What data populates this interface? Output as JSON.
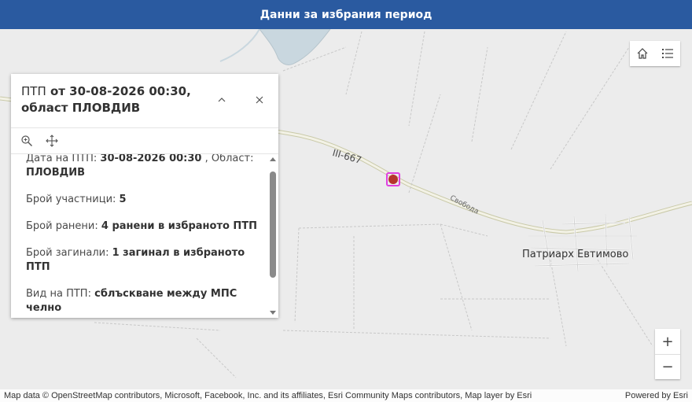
{
  "header": {
    "title": "Данни за избрания период"
  },
  "map": {
    "road_label": "III-667",
    "street_label": "Свобода",
    "village_label": "Патриарх Евтимово",
    "marker_color": "#b5352c",
    "highlight_color": "#e040e0",
    "top_widgets": [
      {
        "icon": "home-icon"
      },
      {
        "icon": "legend-list-icon"
      }
    ],
    "zoom": {
      "in_label": "+",
      "out_label": "−"
    },
    "attribution": {
      "text": "Map data © OpenStreetMap contributors, Microsoft, Facebook, Inc. and its affiliates, Esri Community Maps contributors, Map layer by Esri",
      "powered": "Powered by Esri"
    }
  },
  "popup": {
    "title_prefix": "ПТП",
    "title_rest": " от 30-08-2026 00:30, област ПЛОВДИВ",
    "actions": [
      {
        "icon": "zoom-to-icon"
      },
      {
        "icon": "move-icon"
      }
    ],
    "fields": {
      "date_label": "Дата на ПТП:",
      "date_value": "30-08-2026 00:30",
      "region_label": ", Област:",
      "region_value": "ПЛОВДИВ",
      "participants_label": "Брой участници:",
      "participants_value": "5",
      "injured_label": "Брой ранени:",
      "injured_value": "4 ранени в избраното ПТП",
      "killed_label": "Брой загинали:",
      "killed_value": "1 загинал в избраното ПТП",
      "type_label": "Вид на ПТП:",
      "type_value": "сблъскване между МПС челно"
    }
  }
}
